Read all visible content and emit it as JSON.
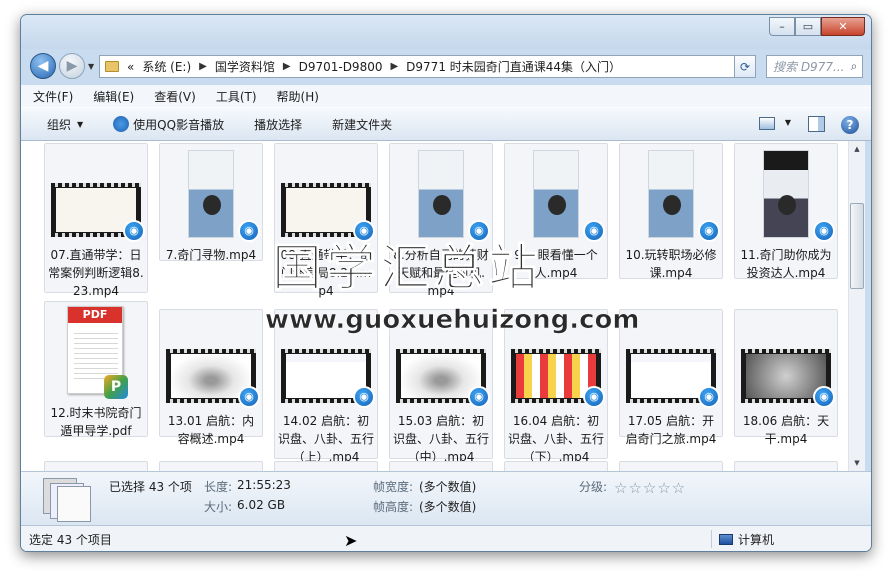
{
  "window": {
    "caption_minimize": "–",
    "caption_maximize": "▭",
    "caption_close": "✕"
  },
  "nav": {
    "back_icon": "back-arrow-icon",
    "forward_icon": "forward-arrow-icon",
    "breadcrumbs": [
      "«",
      "系统 (E:)",
      "国学资料馆",
      "D9701-D9800",
      "D9771 时未园奇门直通课44集（入门）"
    ],
    "search_placeholder": "搜索 D977..."
  },
  "menu": {
    "items": [
      "文件(F)",
      "编辑(E)",
      "查看(V)",
      "工具(T)",
      "帮助(H)"
    ]
  },
  "commandbar": {
    "organize": "组织",
    "play_qq": "使用QQ影音播放",
    "play_select": "播放选择",
    "new_folder": "新建文件夹"
  },
  "files": [
    {
      "name": "07.直通带学：日常案例判断逻辑8.23.mp4",
      "thumb": "banner"
    },
    {
      "name": "7.奇门寻物.mp4",
      "thumb": "portrait"
    },
    {
      "name": "08.直通带学：奇门终身局8.24.mp4",
      "thumb": "banner"
    },
    {
      "name": "8.分析自己的获财天赋和最佳时机.mp4",
      "thumb": "portrait"
    },
    {
      "name": "9.一眼看懂一个人.mp4",
      "thumb": "portrait"
    },
    {
      "name": "10.玩转职场必修课.mp4",
      "thumb": "portrait"
    },
    {
      "name": "11.奇门助你成为投资达人.mp4",
      "thumb": "portrait-dark"
    },
    {
      "name": "12.时末书院奇门遁甲导学.pdf",
      "thumb": "pdf"
    },
    {
      "name": "13.01 启航：内容概述.mp4",
      "thumb": "ink"
    },
    {
      "name": "14.02 启航：初识盘、八卦、五行（上）.mp4",
      "thumb": "slide"
    },
    {
      "name": "15.03 启航：初识盘、八卦、五行（中）.mp4",
      "thumb": "ink"
    },
    {
      "name": "16.04 启航：初识盘、八卦、五行（下）.mp4",
      "thumb": "grid"
    },
    {
      "name": "17.05 启航：开启奇门之旅.mp4",
      "thumb": "slide"
    },
    {
      "name": "18.06 启航：天干.mp4",
      "thumb": "dark"
    }
  ],
  "watermark": {
    "text": "国学汇总站",
    "url": "www.guoxuehuizong.com"
  },
  "details": {
    "selected": "已选择 43 个项",
    "length_label": "长度:",
    "length_value": "21:55:23",
    "size_label": "大小:",
    "size_value": "6.02 GB",
    "frame_width_label": "帧宽度:",
    "frame_width_value": "(多个数值)",
    "frame_height_label": "帧高度:",
    "frame_height_value": "(多个数值)",
    "rating_label": "分级:",
    "rating_stars": "☆☆☆☆☆"
  },
  "status": {
    "left": "选定 43 个项目",
    "right": "计算机"
  },
  "colors": {
    "frame": "#c9dcef",
    "accent": "#1463b8"
  }
}
